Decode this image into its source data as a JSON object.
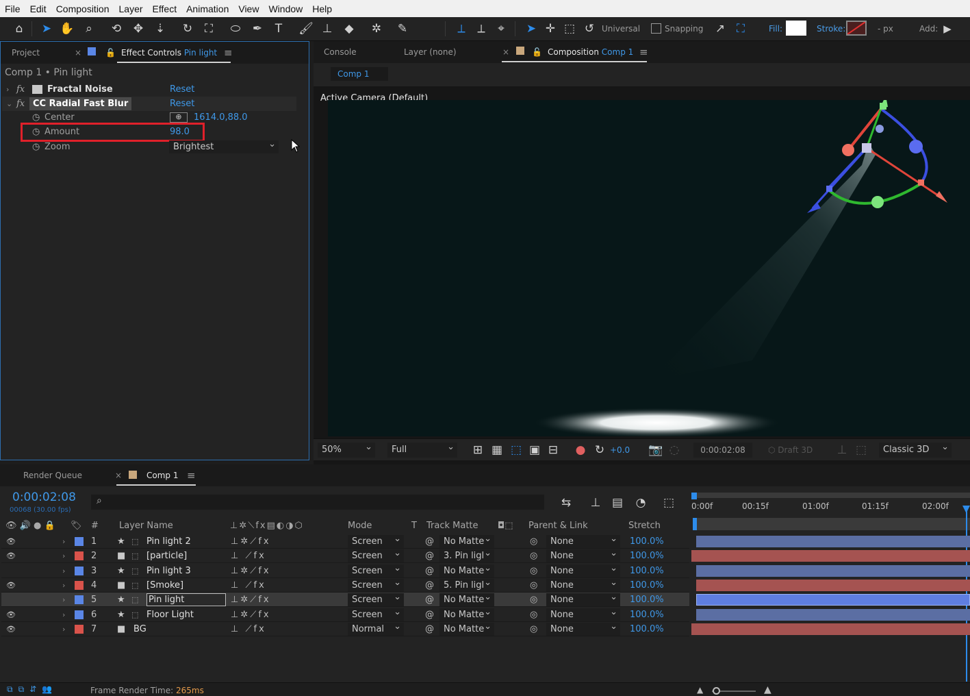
{
  "menu": [
    "File",
    "Edit",
    "Composition",
    "Layer",
    "Effect",
    "Animation",
    "View",
    "Window",
    "Help"
  ],
  "toolbar": {
    "universal_label": "Universal",
    "snapping_label": "Snapping",
    "fill_label": "Fill:",
    "stroke_label": "Stroke:",
    "stroke_width": "- px",
    "add_label": "Add:"
  },
  "left_panel": {
    "tab_project": "Project",
    "tab_effect_controls": "Effect Controls",
    "tab_effect_layer": "Pin light",
    "breadcrumb": "Comp 1 • Pin light",
    "effects": [
      {
        "name": "Fractal Noise",
        "reset": "Reset"
      },
      {
        "name": "CC Radial Fast Blur",
        "reset": "Reset"
      }
    ],
    "props": {
      "center_label": "Center",
      "center_value": "1614.0,88.0",
      "amount_label": "Amount",
      "amount_value": "98.0",
      "zoom_label": "Zoom",
      "zoom_value": "Brightest"
    }
  },
  "comp_panel": {
    "tab_console": "Console",
    "tab_layer": "Layer (none)",
    "tab_composition": "Composition",
    "tab_comp_name": "Comp 1",
    "subtab": "Comp 1",
    "camera_label": "Active Camera (Default)",
    "zoom": "50%",
    "resolution": "Full",
    "exposure": "+0.0",
    "timecode": "0:00:02:08",
    "draft3d": "Draft 3D",
    "renderer": "Classic 3D"
  },
  "timeline": {
    "tab_render_queue": "Render Queue",
    "tab_comp": "Comp 1",
    "timecode": "0:00:02:08",
    "frame_info": "00068 (30.00 fps)",
    "search_placeholder": "",
    "headers": {
      "number": "#",
      "layer_name": "Layer Name",
      "mode": "Mode",
      "t": "T",
      "track_matte": "Track Matte",
      "parent": "Parent & Link",
      "stretch": "Stretch"
    },
    "ruler": [
      "0:00f",
      "00:15f",
      "01:00f",
      "01:15f",
      "02:00f"
    ],
    "layers": [
      {
        "num": "1",
        "name": "Pin light 2",
        "mode": "Screen",
        "matte": "No Matte",
        "parent": "None",
        "stretch": "100.0%",
        "label_color": "#5a86e6",
        "bar_color": "#5b6ea3",
        "visible": "👁"
      },
      {
        "num": "2",
        "name": "[particle]",
        "mode": "Screen",
        "matte": "3. Pin ligl",
        "parent": "None",
        "stretch": "100.0%",
        "label_color": "#d9534b",
        "bar_color": "#a55351",
        "visible": "👁"
      },
      {
        "num": "3",
        "name": "Pin light 3",
        "mode": "Screen",
        "matte": "No Matte",
        "parent": "None",
        "stretch": "100.0%",
        "label_color": "#5a86e6",
        "bar_color": "#5b6ea3",
        "visible": ""
      },
      {
        "num": "4",
        "name": "[Smoke]",
        "mode": "Screen",
        "matte": "5. Pin ligl",
        "parent": "None",
        "stretch": "100.0%",
        "label_color": "#d9534b",
        "bar_color": "#a55351",
        "visible": "👁"
      },
      {
        "num": "5",
        "name": "Pin light",
        "mode": "Screen",
        "matte": "No Matte",
        "parent": "None",
        "stretch": "100.0%",
        "label_color": "#5a86e6",
        "bar_color": "#5f7ee0",
        "visible": ""
      },
      {
        "num": "6",
        "name": "Floor Light",
        "mode": "Screen",
        "matte": "No Matte",
        "parent": "None",
        "stretch": "100.0%",
        "label_color": "#5a86e6",
        "bar_color": "#5b6ea3",
        "visible": "👁"
      },
      {
        "num": "7",
        "name": "BG",
        "mode": "Normal",
        "matte": "No Matte",
        "parent": "None",
        "stretch": "100.0%",
        "label_color": "#d9534b",
        "bar_color": "#a55351",
        "visible": "👁"
      }
    ],
    "footer_label": "Frame Render Time:",
    "footer_value": "265ms"
  },
  "colors": {
    "accent": "#3f98e8",
    "highlight_box": "#e0202a"
  }
}
